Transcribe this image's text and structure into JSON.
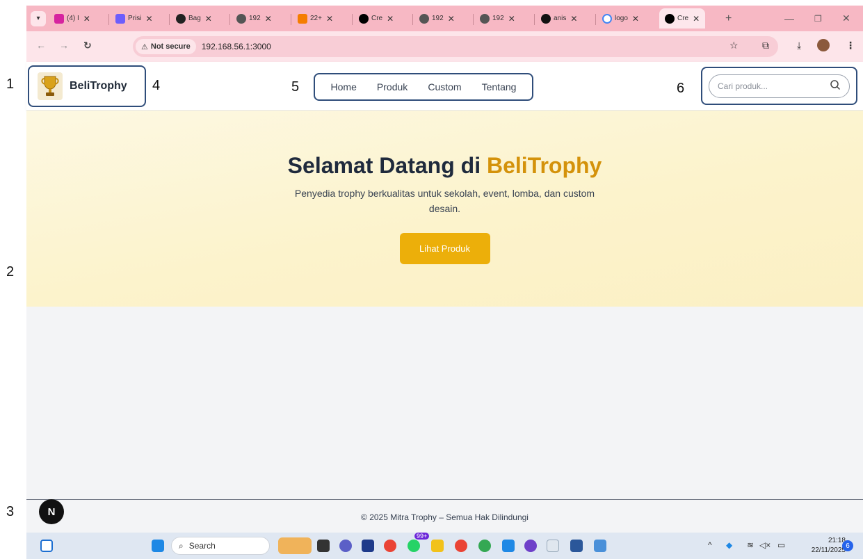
{
  "browser": {
    "tabs": [
      {
        "label": "(4) I",
        "icon": "instagram-icon",
        "color": "#d6249f"
      },
      {
        "label": "Prisi",
        "icon": "prisma-icon",
        "color": "#6d5dfc"
      },
      {
        "label": "Bag",
        "icon": "openai-icon",
        "color": "#222222"
      },
      {
        "label": "192",
        "icon": "globe-icon",
        "color": "#555555"
      },
      {
        "label": "22+",
        "icon": "blogger-icon",
        "color": "#f57d00"
      },
      {
        "label": "Cre",
        "icon": "vercel-icon",
        "color": "#000000"
      },
      {
        "label": "192",
        "icon": "globe-icon",
        "color": "#555555"
      },
      {
        "label": "192",
        "icon": "globe-icon",
        "color": "#555555"
      },
      {
        "label": "anis",
        "icon": "github-icon",
        "color": "#111111"
      },
      {
        "label": "logo",
        "icon": "google-icon",
        "color": "#4285f4"
      },
      {
        "label": "Cre",
        "icon": "vercel-icon",
        "color": "#000000",
        "active": true
      }
    ],
    "security_label": "Not secure",
    "url": "192.168.56.1:3000"
  },
  "header": {
    "brand_name": "BeliTrophy",
    "nav": [
      "Home",
      "Produk",
      "Custom",
      "Tentang"
    ],
    "search_placeholder": "Cari produk..."
  },
  "hero": {
    "title_prefix": "Selamat Datang di ",
    "title_accent": "BeliTrophy",
    "subtitle": "Penyedia trophy berkualitas untuk sekolah, event, lomba, dan custom desain.",
    "cta_label": "Lihat Produk"
  },
  "footer": {
    "text": "© 2025 Mitra Trophy – Semua Hak Dilindungi",
    "badge": "N"
  },
  "annotations": [
    "1",
    "2",
    "3",
    "4",
    "5",
    "6"
  ],
  "taskbar": {
    "search_label": "Search",
    "badge_count": "99+",
    "time": "21:18",
    "date": "22/11/2025",
    "notifications": "6"
  },
  "colors": {
    "accent": "#ecaf0a",
    "accent_text": "#d4920b",
    "outline": "#2f4d7a",
    "tabstrip": "#f7b8c4"
  }
}
